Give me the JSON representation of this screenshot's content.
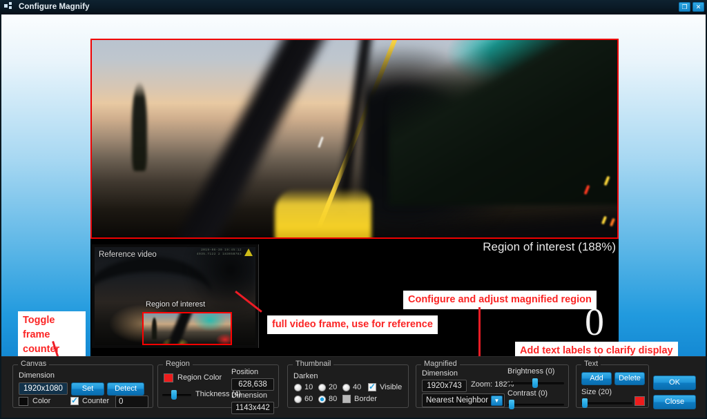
{
  "window": {
    "title": "Configure Magnify",
    "icon": "app-squares-icon",
    "buttons": [
      {
        "name": "restore-button",
        "glyph": "❐"
      },
      {
        "name": "close-button",
        "glyph": "✕"
      }
    ]
  },
  "viewer": {
    "roi_label": "Region of interest (188%)",
    "frame_counter": "0",
    "reference_label": "Reference video",
    "reference_roi_label": "Region of interest",
    "osd_text": "2019-06-30 19:45:12\n4935.7122 2 18305B783"
  },
  "annotations": [
    {
      "name": "callout-toggle-frame-counter",
      "text": "Toggle frame\ncounter"
    },
    {
      "name": "callout-full-video-frame",
      "text": "full video frame, use for reference"
    },
    {
      "name": "callout-configure-magnified-region",
      "text": "Configure and adjust magnified region"
    },
    {
      "name": "callout-add-text-labels",
      "text": "Add text labels to clarify display"
    }
  ],
  "canvas": {
    "legend": "Canvas",
    "dimension_label": "Dimension",
    "dimension_value": "1920x1080",
    "set_button": "Set",
    "detect_button": "Detect",
    "color_label": "Color",
    "color_swatch": "#0a0a0a",
    "counter_label": "Counter",
    "counter_checked": true,
    "counter_value": "0"
  },
  "region": {
    "legend": "Region",
    "region_color_label": "Region Color",
    "region_color_swatch": "#ee1c1c",
    "thickness_label": "Thickness (4)",
    "thickness_percent": 30,
    "position_label": "Position",
    "position_value": "628,638",
    "dimension_label": "Dimension",
    "dimension_value": "1143x442"
  },
  "thumbnail": {
    "legend": "Thumbnail",
    "darken_label": "Darken",
    "options": [
      {
        "label": "10",
        "selected": false
      },
      {
        "label": "20",
        "selected": false
      },
      {
        "label": "40",
        "selected": false
      },
      {
        "label": "60",
        "selected": false
      },
      {
        "label": "80",
        "selected": true
      }
    ],
    "visible_label": "Visible",
    "visible_checked": true,
    "border_label": "Border",
    "border_checked": false
  },
  "magnified": {
    "legend": "Magnified",
    "dimension_label": "Dimension",
    "dimension_value": "1920x743",
    "zoom_label": "Zoom: 182%",
    "interpolation_value": "Nearest Neighbor",
    "brightness_label": "Brightness (0)",
    "brightness_percent": 50,
    "contrast_label": "Contrast (0)",
    "contrast_percent": 3
  },
  "text": {
    "legend": "Text",
    "add_button": "Add",
    "delete_button": "Delete",
    "size_label": "Size (20)",
    "size_percent": 3,
    "color_swatch": "#ee1c1c"
  },
  "dialog": {
    "ok_button": "OK",
    "close_button": "Close"
  },
  "colors": {
    "accent": "#1e9fe0",
    "annotation_red": "#fb2424",
    "region_red": "#ff0000",
    "panel_bg": "#1d1d1d"
  }
}
